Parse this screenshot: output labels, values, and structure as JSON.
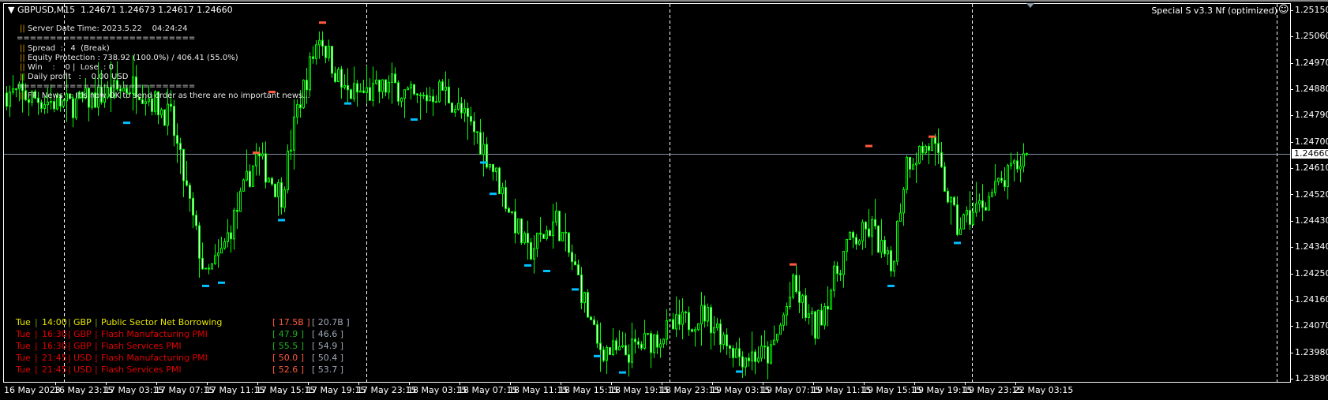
{
  "header": {
    "symbol": "GBPUSD,M15",
    "ohlc": "1.24671 1.24673 1.24617 1.24660"
  },
  "ea_label": "Special S v3.3 Nf (optimized)",
  "info": {
    "server_time": "Server Date Time: 2023.5.22    04:24:24",
    "separator": "===========================",
    "spread": "Spread  :   4  (Break)",
    "equity": "Equity Protection : 738.92 (100.0%) / 406.41 (55.0%)",
    "win_lose": "Win    :    0 |  Lose  : 0",
    "daily_profit": "Daily profit   :    0.00 USD",
    "ff_news": "FF  News   : It's now OK to send order as there are no important news...",
    "pipe": "||"
  },
  "news": [
    {
      "day": "Tue",
      "time": "14:00",
      "cur": "GBP",
      "event": "Public Sector Net Borrowing",
      "actual": "[ 17.5B ]",
      "prev": "[ 20.7B ]",
      "color": "#e6e600",
      "sep_color": "#7fa000",
      "actual_color": "#ff5a3c"
    },
    {
      "day": "Tue",
      "time": "16:30",
      "cur": "GBP",
      "event": "Flash Manufacturing PMI",
      "actual": "[ 47.9 ]",
      "prev": "[ 46.6 ]",
      "color": "#e00000",
      "sep_color": "#e00000",
      "actual_color": "#20b020"
    },
    {
      "day": "Tue",
      "time": "16:30",
      "cur": "GBP",
      "event": "Flash Services PMI",
      "actual": "[ 55.5 ]",
      "prev": "[ 54.9 ]",
      "color": "#e00000",
      "sep_color": "#e00000",
      "actual_color": "#20b020"
    },
    {
      "day": "Tue",
      "time": "21:45",
      "cur": "USD",
      "event": "Flash Manufacturing PMI",
      "actual": "[ 50.0 ]",
      "prev": "[ 50.4 ]",
      "color": "#e00000",
      "sep_color": "#e00000",
      "actual_color": "#ff5a3c"
    },
    {
      "day": "Tue",
      "time": "21:45",
      "cur": "USD",
      "event": "Flash Services PMI",
      "actual": "[ 52.6 ]",
      "prev": "[ 53.7 ]",
      "color": "#e00000",
      "sep_color": "#e00000",
      "actual_color": "#ff5a3c"
    }
  ],
  "news_prev_color": "#a0a8b8",
  "current_price": "1.24660",
  "chart_data": {
    "type": "candlestick",
    "symbol": "GBPUSD",
    "timeframe": "M15",
    "ylim": [
      1.2389,
      1.2515
    ],
    "price_labels": [
      "1.25150",
      "1.25060",
      "1.24970",
      "1.24880",
      "1.24790",
      "1.24700",
      "1.24610",
      "1.24520",
      "1.24430",
      "1.24340",
      "1.24250",
      "1.24160",
      "1.24070",
      "1.23980",
      "1.23890"
    ],
    "time_labels": [
      "16 May 2023",
      "16 May 23:15",
      "17 May 03:15",
      "17 May 07:15",
      "17 May 11:15",
      "17 May 15:15",
      "17 May 19:15",
      "17 May 23:15",
      "18 May 03:15",
      "18 May 07:15",
      "18 May 11:15",
      "18 May 15:15",
      "18 May 19:15",
      "18 May 23:15",
      "19 May 03:15",
      "19 May 07:15",
      "19 May 11:15",
      "19 May 15:15",
      "19 May 19:15",
      "19 May 23:15",
      "22 May 03:15"
    ],
    "bars_count": 324,
    "price_path": [
      [
        1,
        1.24867
      ],
      [
        20,
        1.24824
      ],
      [
        41,
        1.24896
      ],
      [
        52,
        1.2478
      ],
      [
        63,
        1.2423
      ],
      [
        68,
        1.24318
      ],
      [
        79,
        1.2465
      ],
      [
        87,
        1.2452
      ],
      [
        92,
        1.2481
      ],
      [
        99,
        1.25069
      ],
      [
        107,
        1.24867
      ],
      [
        116,
        1.24867
      ],
      [
        122,
        1.24896
      ],
      [
        130,
        1.24838
      ],
      [
        138,
        1.24882
      ],
      [
        149,
        1.24722
      ],
      [
        154,
        1.24608
      ],
      [
        165,
        1.24318
      ],
      [
        174,
        1.24433
      ],
      [
        181,
        1.2423
      ],
      [
        187,
        1.24
      ],
      [
        195,
        1.23971
      ],
      [
        210,
        1.24057
      ],
      [
        221,
        1.24115
      ],
      [
        232,
        1.23971
      ],
      [
        242,
        1.23971
      ],
      [
        249,
        1.24202
      ],
      [
        256,
        1.24057
      ],
      [
        266,
        1.24346
      ],
      [
        274,
        1.24405
      ],
      [
        280,
        1.2426
      ],
      [
        285,
        1.24636
      ],
      [
        293,
        1.24694
      ],
      [
        301,
        1.24405
      ],
      [
        309,
        1.24492
      ],
      [
        317,
        1.24578
      ],
      [
        323,
        1.2466
      ]
    ],
    "low_markers": [
      [
        38,
        1.24772
      ],
      [
        63,
        1.24214
      ],
      [
        68,
        1.24225
      ],
      [
        87,
        1.24439
      ],
      [
        108,
        1.24838
      ],
      [
        129,
        1.24783
      ],
      [
        151,
        1.24636
      ],
      [
        154,
        1.24529
      ],
      [
        165,
        1.24284
      ],
      [
        171,
        1.24265
      ],
      [
        180,
        1.24202
      ],
      [
        187,
        1.23974
      ],
      [
        195,
        1.23918
      ],
      [
        232,
        1.23921
      ],
      [
        280,
        1.24214
      ],
      [
        301,
        1.24361
      ]
    ],
    "high_markers": [
      [
        84,
        1.24864
      ],
      [
        100,
        1.25101
      ],
      [
        79,
        1.24656
      ],
      [
        249,
        1.24274
      ],
      [
        273,
        1.24679
      ],
      [
        293,
        1.24711
      ]
    ],
    "period_separators": [
      "16 May 2023",
      "17 May 2023",
      "18 May 2023",
      "19 May 2023",
      "22 May 2023"
    ],
    "colors": {
      "candle": "#00ff00",
      "bear_body": "#ffffff",
      "low_marker": "#00bfff",
      "high_marker": "#ff5a3c",
      "price_line": "#8090a0"
    }
  }
}
